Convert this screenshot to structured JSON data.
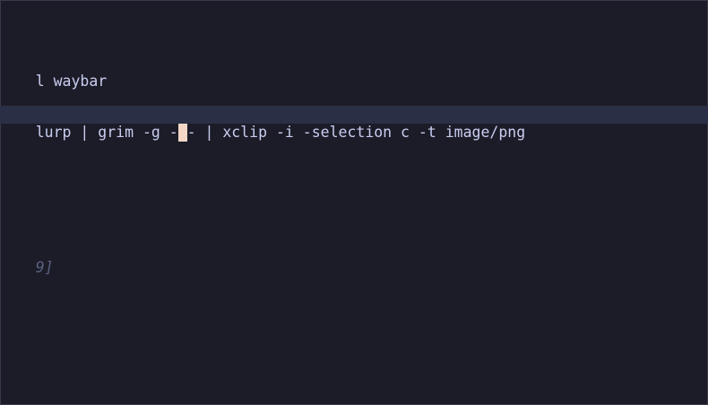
{
  "editor": {
    "lines": {
      "line1": "l waybar",
      "line2_before": "lurp | grim -g -",
      "line2_cursor": " ",
      "line2_after": "- | xclip -i -selection c -t image/png",
      "line3": "9]"
    },
    "colors": {
      "background": "#1c1c28",
      "text": "#c9cdf0",
      "current_line": "#2a2f45",
      "cursor": "#f5d7c8",
      "comment": "#5b6180"
    }
  }
}
